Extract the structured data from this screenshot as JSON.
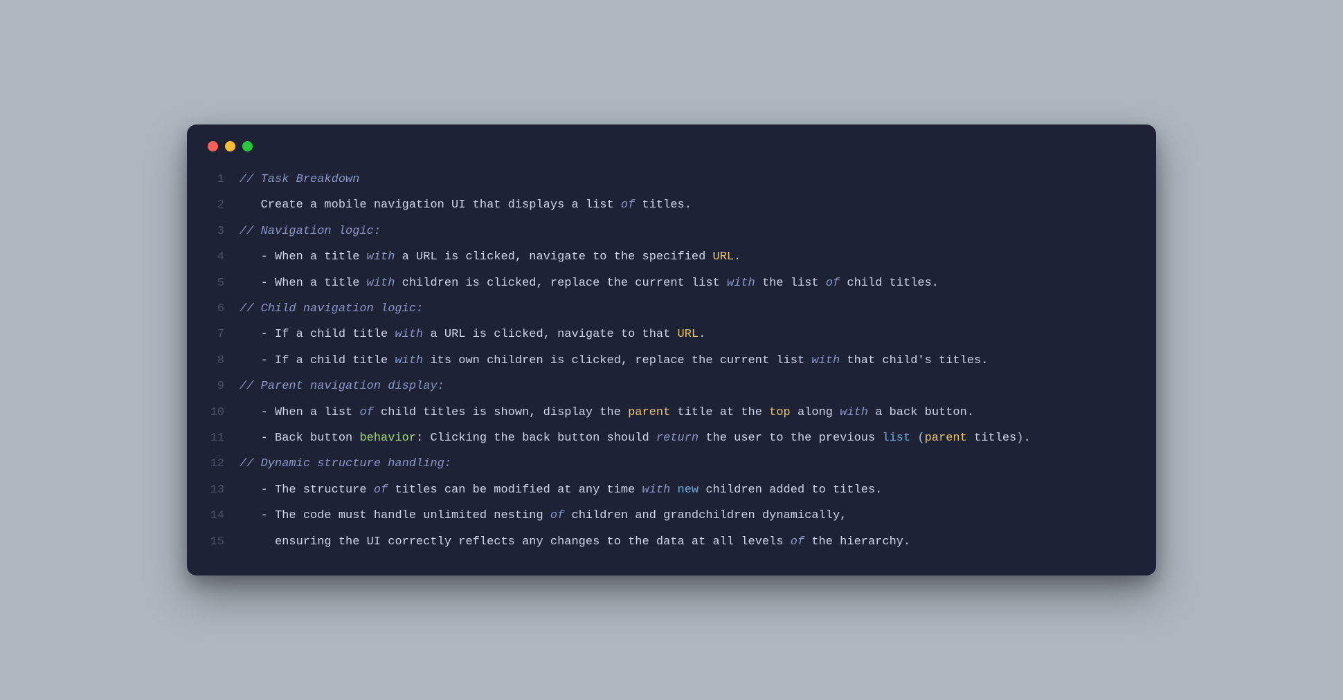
{
  "window": {
    "traffic_lights": [
      "red",
      "yellow",
      "green"
    ]
  },
  "code": {
    "lines": [
      {
        "num": "1",
        "indent": "",
        "tokens": [
          {
            "t": "// Task Breakdown",
            "c": "comment"
          }
        ]
      },
      {
        "num": "2",
        "indent": "   ",
        "tokens": [
          {
            "t": "Create a mobile navigation UI that displays a list ",
            "c": "plain"
          },
          {
            "t": "of",
            "c": "keyword"
          },
          {
            "t": " titles.",
            "c": "plain"
          }
        ]
      },
      {
        "num": "3",
        "indent": "",
        "tokens": [
          {
            "t": "// Navigation logic:",
            "c": "comment"
          }
        ]
      },
      {
        "num": "4",
        "indent": "   ",
        "tokens": [
          {
            "t": "- When a title ",
            "c": "plain"
          },
          {
            "t": "with",
            "c": "keyword"
          },
          {
            "t": " a URL is clicked, navigate to the specified ",
            "c": "plain"
          },
          {
            "t": "URL",
            "c": "ident"
          },
          {
            "t": ".",
            "c": "plain"
          }
        ]
      },
      {
        "num": "5",
        "indent": "   ",
        "tokens": [
          {
            "t": "- When a title ",
            "c": "plain"
          },
          {
            "t": "with",
            "c": "keyword"
          },
          {
            "t": " children is clicked, replace the current list ",
            "c": "plain"
          },
          {
            "t": "with",
            "c": "keyword"
          },
          {
            "t": " the list ",
            "c": "plain"
          },
          {
            "t": "of",
            "c": "keyword"
          },
          {
            "t": " child titles.",
            "c": "plain"
          }
        ]
      },
      {
        "num": "6",
        "indent": "",
        "tokens": [
          {
            "t": "// Child navigation logic:",
            "c": "comment"
          }
        ]
      },
      {
        "num": "7",
        "indent": "   ",
        "tokens": [
          {
            "t": "- If a child title ",
            "c": "plain"
          },
          {
            "t": "with",
            "c": "keyword"
          },
          {
            "t": " a URL is clicked, navigate to that ",
            "c": "plain"
          },
          {
            "t": "URL",
            "c": "ident"
          },
          {
            "t": ".",
            "c": "plain"
          }
        ]
      },
      {
        "num": "8",
        "indent": "   ",
        "tokens": [
          {
            "t": "- If a child title ",
            "c": "plain"
          },
          {
            "t": "with",
            "c": "keyword"
          },
          {
            "t": " its own children is clicked, replace the current list ",
            "c": "plain"
          },
          {
            "t": "with",
            "c": "keyword"
          },
          {
            "t": " that child's titles.",
            "c": "plain"
          }
        ]
      },
      {
        "num": "9",
        "indent": "",
        "tokens": [
          {
            "t": "// Parent navigation display:",
            "c": "comment"
          }
        ]
      },
      {
        "num": "10",
        "indent": "   ",
        "tokens": [
          {
            "t": "- When a list ",
            "c": "plain"
          },
          {
            "t": "of",
            "c": "keyword"
          },
          {
            "t": " child titles is shown, display the ",
            "c": "plain"
          },
          {
            "t": "parent",
            "c": "ident"
          },
          {
            "t": " title at the ",
            "c": "plain"
          },
          {
            "t": "top",
            "c": "ident"
          },
          {
            "t": " along ",
            "c": "plain"
          },
          {
            "t": "with",
            "c": "keyword"
          },
          {
            "t": " a back button.",
            "c": "plain"
          }
        ]
      },
      {
        "num": "11",
        "indent": "   ",
        "tokens": [
          {
            "t": "- Back button ",
            "c": "plain"
          },
          {
            "t": "behavior",
            "c": "func"
          },
          {
            "t": ": Clicking the back button should ",
            "c": "plain"
          },
          {
            "t": "return",
            "c": "keyword"
          },
          {
            "t": " the user to the previous ",
            "c": "plain"
          },
          {
            "t": "list",
            "c": "builtin"
          },
          {
            "t": " ",
            "c": "plain"
          },
          {
            "t": "(",
            "c": "punct"
          },
          {
            "t": "parent",
            "c": "ident"
          },
          {
            "t": " titles",
            "c": "plain"
          },
          {
            "t": ")",
            "c": "punct"
          },
          {
            "t": ".",
            "c": "plain"
          }
        ]
      },
      {
        "num": "12",
        "indent": "",
        "tokens": [
          {
            "t": "// Dynamic structure handling:",
            "c": "comment"
          }
        ]
      },
      {
        "num": "13",
        "indent": "   ",
        "tokens": [
          {
            "t": "- The structure ",
            "c": "plain"
          },
          {
            "t": "of",
            "c": "keyword"
          },
          {
            "t": " titles can be modified at any time ",
            "c": "plain"
          },
          {
            "t": "with",
            "c": "keyword"
          },
          {
            "t": " ",
            "c": "plain"
          },
          {
            "t": "new",
            "c": "builtin"
          },
          {
            "t": " children added to titles.",
            "c": "plain"
          }
        ]
      },
      {
        "num": "14",
        "indent": "   ",
        "tokens": [
          {
            "t": "- The code must handle unlimited nesting ",
            "c": "plain"
          },
          {
            "t": "of",
            "c": "keyword"
          },
          {
            "t": " children and grandchildren dynamically,",
            "c": "plain"
          }
        ]
      },
      {
        "num": "15",
        "indent": "     ",
        "tokens": [
          {
            "t": "ensuring the UI correctly reflects any changes to the data at all levels ",
            "c": "plain"
          },
          {
            "t": "of",
            "c": "keyword"
          },
          {
            "t": " the hierarchy.",
            "c": "plain"
          }
        ]
      }
    ]
  }
}
